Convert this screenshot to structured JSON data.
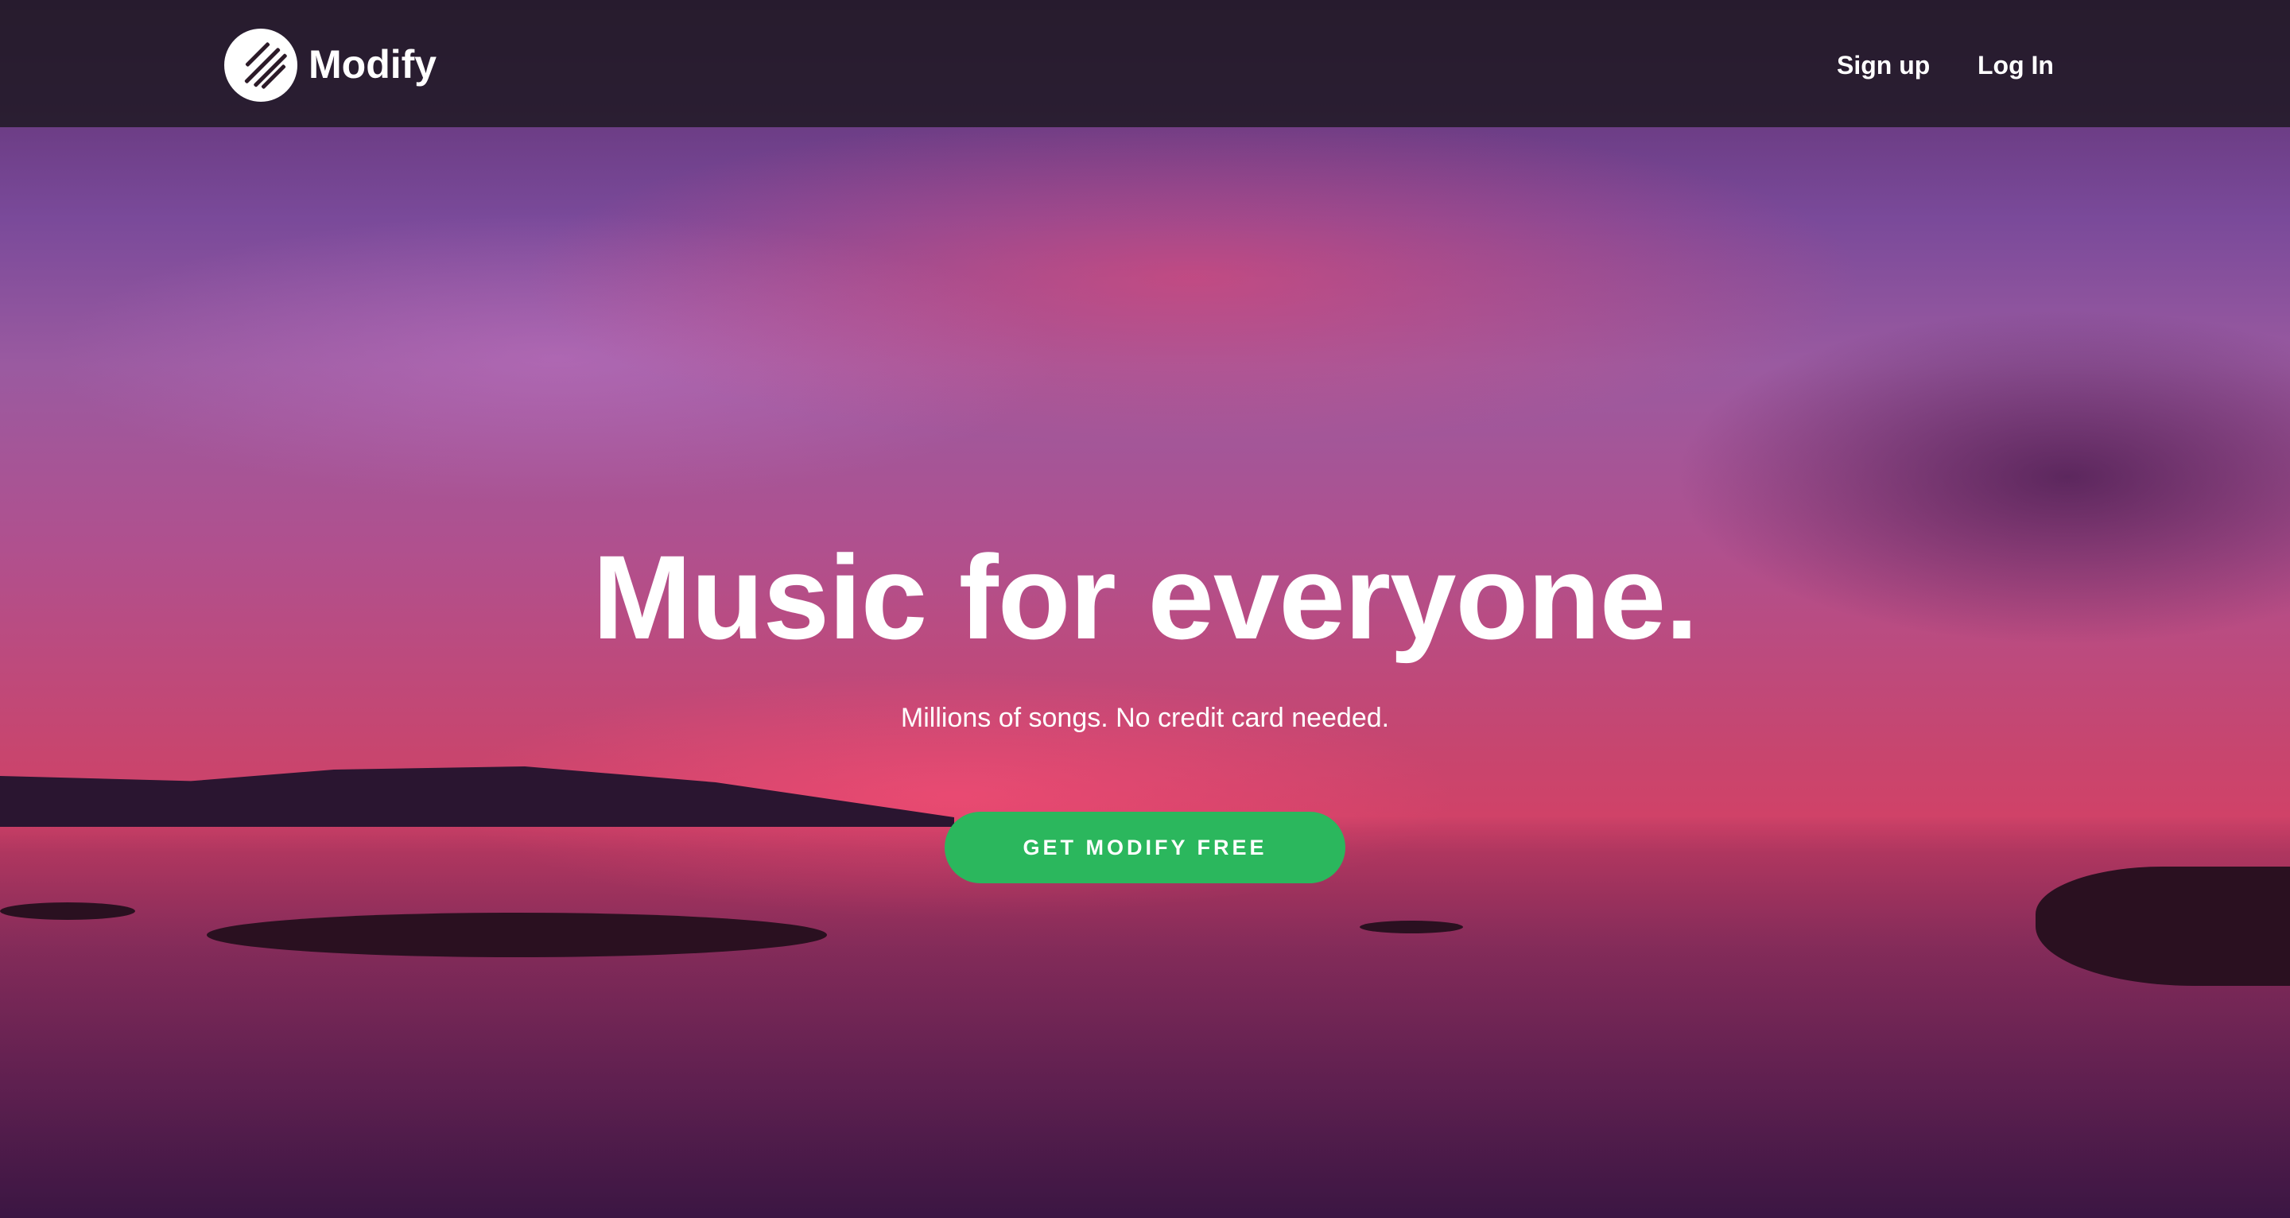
{
  "header": {
    "brand": "Modify",
    "logo_icon": "striped-circle-logo",
    "nav": {
      "signup": "Sign up",
      "login": "Log In"
    }
  },
  "hero": {
    "title": "Music for everyone.",
    "subtitle": "Millions of songs. No credit card needed.",
    "cta": "GET MODIFY FREE"
  },
  "colors": {
    "cta": "#2bb75d",
    "header": "#1e1923"
  }
}
